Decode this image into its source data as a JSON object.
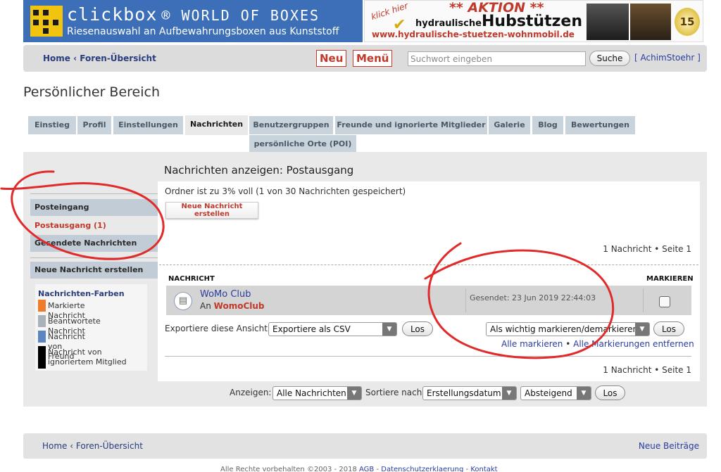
{
  "banner_left": {
    "title": "clickbox",
    "title_suffix": "® WORLD OF BOXES",
    "subtitle": "Riesenauswahl an Aufbewahrungsboxen aus Kunststoff"
  },
  "banner_right": {
    "klick_hier": "klick hier",
    "aktion": "** AKTION **",
    "hydraulische": "hydraulische",
    "hubstuetzen": "Hubstützen",
    "url": "www.hydraulische-stuetzen-wohnmobil.de",
    "badge": "15"
  },
  "navbar": {
    "home": "Home",
    "separator": "‹",
    "forum_overview": "Foren-Übersicht",
    "new_button": "Neu",
    "menu_button": "Menü",
    "search_placeholder": "Suchwort eingeben",
    "search_button": "Suche",
    "user": "[ AchimStoehr ]"
  },
  "page_title": "Persönlicher Bereich",
  "tabs": [
    {
      "label": "Einstieg"
    },
    {
      "label": "Profil"
    },
    {
      "label": "Einstellungen"
    },
    {
      "label": "Nachrichten"
    },
    {
      "label": "Benutzergruppen"
    },
    {
      "label": "Freunde und ignorierte Mitglieder"
    },
    {
      "label": "Galerie"
    },
    {
      "label": "Blog"
    },
    {
      "label": "Bewertungen"
    },
    {
      "label": "persönliche Orte (POI)"
    }
  ],
  "active_tab": "Nachrichten",
  "sidebar": {
    "items": [
      {
        "label": "Posteingang"
      },
      {
        "label": "Postausgang (1)"
      },
      {
        "label": "Gesendete Nachrichten"
      }
    ],
    "compose": "Neue Nachricht erstellen",
    "legend_title": "Nachrichten-Farben",
    "legend": [
      {
        "label": "Markierte Nachricht",
        "color": "#f07b2a"
      },
      {
        "label": "Beantwortete Nachricht",
        "color": "#a9b2bb"
      },
      {
        "label": "Nachricht von Freund",
        "color": "#5b86c0"
      },
      {
        "label": "Nachricht von ignoriertem Mitglied",
        "color": "#000000"
      }
    ]
  },
  "content": {
    "title": "Nachrichten anzeigen: Postausgang",
    "folder_status": "Ordner ist zu 3% voll (1 von 30 Nachrichten gespeichert)",
    "new_message_button": "Neue Nachricht erstellen",
    "pagination": "1 Nachricht • Seite 1",
    "col_message": "NACHRICHT",
    "col_mark": "MARKIEREN",
    "message": {
      "subject": "WoMo Club",
      "to_prefix": "An",
      "recipient": "WomoClub",
      "sent": "Gesendet: 23 Jun 2019 22:44:03"
    },
    "export_label": "Exportiere diese Ansicht:",
    "export_value": "Exportiere als CSV",
    "go_button": "Los",
    "mark_action": "Als wichtig markieren/demarkieren",
    "mark_all": "Alle markieren",
    "mark_sep": "•",
    "unmark_all": "Alle Markierungen entfernen",
    "display_label": "Anzeigen:",
    "display_value": "Alle Nachrichten",
    "sort_label": "Sortiere nach",
    "sort_value": "Erstellungsdatum",
    "order_value": "Absteigend"
  },
  "footer": {
    "home": "Home",
    "separator": "‹",
    "forum_overview": "Foren-Übersicht",
    "new_posts": "Neue Beiträge",
    "copyright": "Alle Rechte vorbehalten ©2003 - 2018",
    "agb": "AGB",
    "dash": "-",
    "datenschutz": "Datenschutzerklaerung",
    "kontakt": "Kontakt"
  },
  "colors": {
    "accent_red": "#c0392b",
    "link_blue": "#2a3d9d",
    "tab_bg": "#c9d3dc",
    "annotation_red": "#e02b2b"
  }
}
